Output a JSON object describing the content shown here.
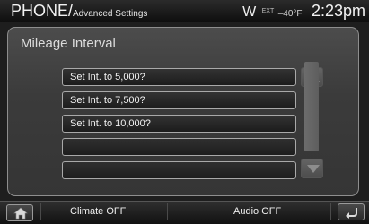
{
  "header": {
    "title": "PHONE/",
    "subtitle": "Advanced Settings",
    "signal_icon": "W",
    "ext_label": "EXT",
    "temperature": "–40°F",
    "clock": "2:23pm"
  },
  "panel": {
    "heading": "Mileage Interval",
    "options": [
      {
        "label": "Set Int. to 5,000?"
      },
      {
        "label": "Set Int. to 7,500?"
      },
      {
        "label": "Set Int. to 10,000?"
      },
      {
        "label": ""
      },
      {
        "label": ""
      }
    ]
  },
  "footer": {
    "climate_label": "Climate OFF",
    "audio_label": "Audio OFF"
  },
  "icons": {
    "home": "home-icon",
    "back": "back-arrow-icon",
    "scroll_up": "triangle-up-icon",
    "scroll_down": "triangle-down-icon"
  }
}
